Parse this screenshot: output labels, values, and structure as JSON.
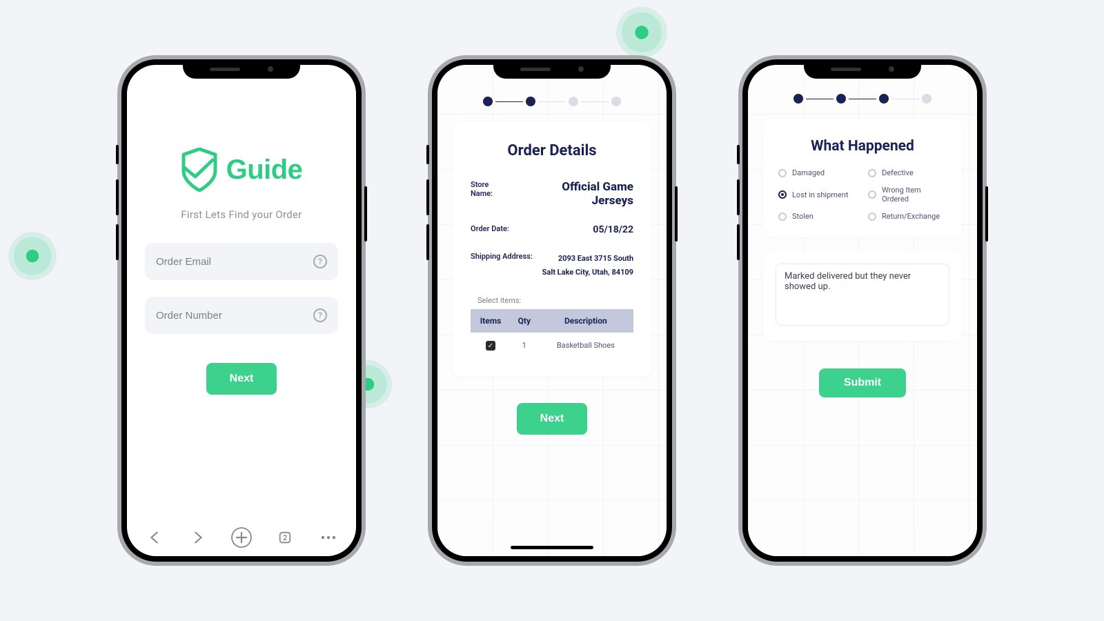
{
  "brand": {
    "name": "Guide"
  },
  "screen1": {
    "subtitle": "First Lets Find your Order",
    "email_placeholder": "Order Email",
    "number_placeholder": "Order Number",
    "next_label": "Next",
    "nav": {
      "tabs_badge": "2"
    }
  },
  "screen2": {
    "steps_done": 2,
    "steps_total": 4,
    "card_title": "Order Details",
    "store_label": "Store Name:",
    "store_value": "Official Game Jerseys",
    "date_label": "Order Date:",
    "date_value": "05/18/22",
    "ship_label": "Shipping Address:",
    "ship_line1": "2093 East 3715 South",
    "ship_line2": "Salt Lake City, Utah, 84109",
    "select_items_label": "Select items:",
    "table_headers": {
      "items": "Items",
      "qty": "Qty",
      "desc": "Description"
    },
    "rows": [
      {
        "checked": true,
        "qty": "1",
        "desc": "Basketball Shoes"
      }
    ],
    "next_label": "Next"
  },
  "screen3": {
    "steps_done": 3,
    "steps_total": 4,
    "card_title": "What Happened",
    "options": [
      {
        "label": "Damaged",
        "selected": false
      },
      {
        "label": "Defective",
        "selected": false
      },
      {
        "label": "Lost in shipment",
        "selected": true
      },
      {
        "label": "Wrong Item Ordered",
        "selected": false
      },
      {
        "label": "Stolen",
        "selected": false
      },
      {
        "label": "Return/Exchange",
        "selected": false
      }
    ],
    "note_value": "Marked delivered but they never showed up.",
    "submit_label": "Submit"
  }
}
